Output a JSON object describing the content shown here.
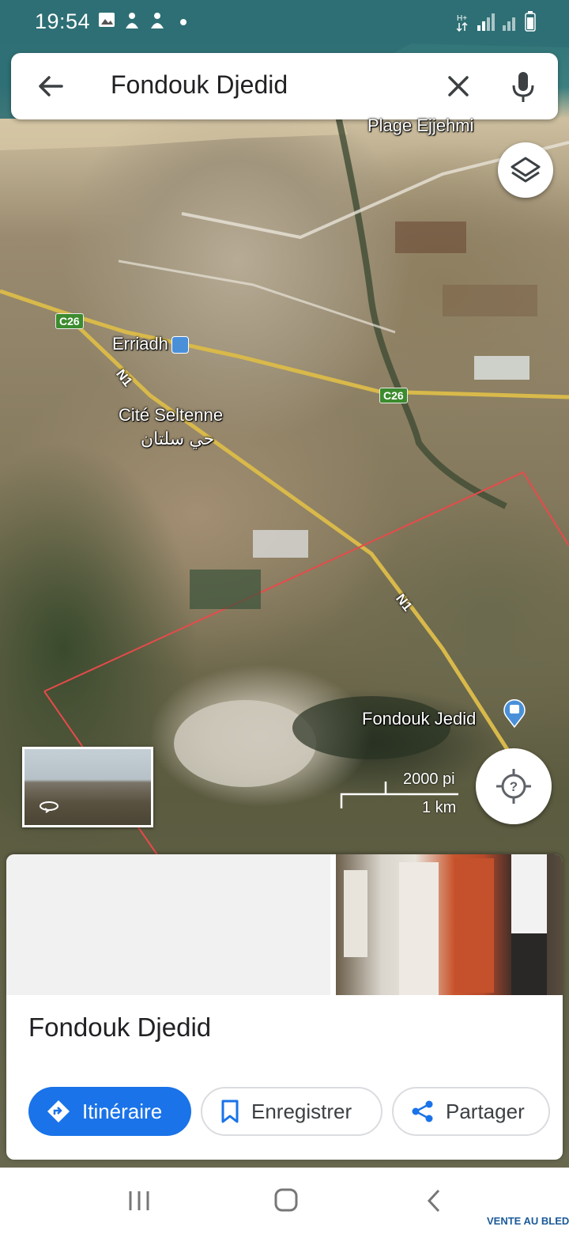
{
  "status_bar": {
    "time": "19:54"
  },
  "search": {
    "query": "Fondouk Djedid"
  },
  "map": {
    "labels": {
      "beach": "Plage Ejjehmi",
      "town1": "Erriadh",
      "town2": "Cité Seltenne",
      "town2_ar": "حي سلتان",
      "station": "Fondouk Jedid"
    },
    "roads": {
      "c26": "C26",
      "n1": "N1"
    },
    "scale": {
      "imperial": "2000 pi",
      "metric": "1 km"
    }
  },
  "card": {
    "title": "Fondouk Djedid",
    "actions": {
      "directions": "Itinéraire",
      "save": "Enregistrer",
      "share": "Partager"
    }
  },
  "watermark": "VENTE AU BLED",
  "colors": {
    "accent": "#1a73e8",
    "boundary": "#e84a4a",
    "road": "#3c8b2e"
  }
}
